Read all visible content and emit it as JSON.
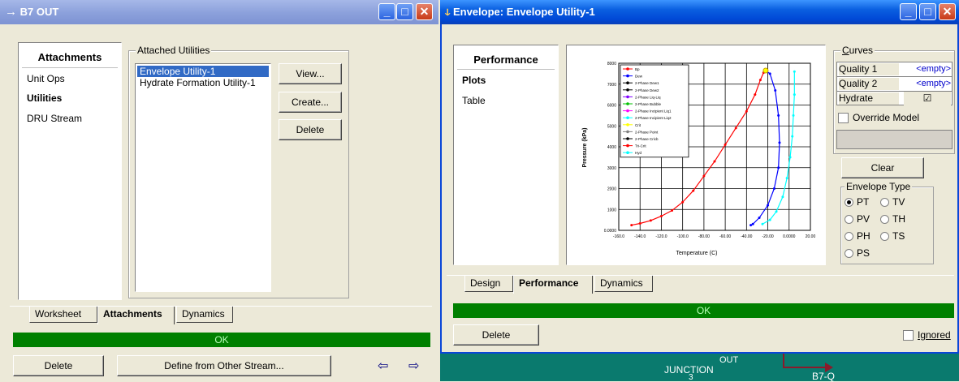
{
  "left_window": {
    "title": "B7 OUT",
    "title_arrow": "→",
    "nav_header": "Attachments",
    "nav_items": [
      "Unit Ops",
      "Utilities",
      "DRU Stream"
    ],
    "attached_utilities_label": "Attached Utilities",
    "utilities": [
      "Envelope Utility-1",
      "Hydrate Formation Utility-1"
    ],
    "buttons": {
      "view": "View...",
      "create": "Create...",
      "delete": "Delete"
    },
    "tabs": [
      "Worksheet",
      "Attachments",
      "Dynamics"
    ],
    "status": "OK",
    "footer": {
      "delete": "Delete",
      "define": "Define from Other Stream...",
      "prev_arrow": "⇦",
      "next_arrow": "⇨"
    }
  },
  "right_window": {
    "title": "Envelope: Envelope Utility-1",
    "nav_header": "Performance",
    "nav_items": [
      "Plots",
      "Table"
    ],
    "curves_label": "Curves",
    "curves": [
      {
        "name": "Quality 1",
        "value": "<empty>"
      },
      {
        "name": "Quality 2",
        "value": "<empty>"
      },
      {
        "name": "Hydrate",
        "value": "☑"
      }
    ],
    "override_model": "Override Model",
    "clear": "Clear",
    "envelope_type_label": "Envelope Type",
    "envelope_types": [
      [
        "PT",
        "TV"
      ],
      [
        "PV",
        "TH"
      ],
      [
        "PH",
        "TS"
      ],
      [
        "PS"
      ]
    ],
    "selected_envelope_type": "PT",
    "tabs": [
      "Design",
      "Performance",
      "Dynamics"
    ],
    "status": "OK",
    "delete": "Delete",
    "ignored": "Ignored"
  },
  "canvas": {
    "labels": [
      "JUNCTION",
      "OUT",
      "3",
      "B7-Q"
    ]
  },
  "chart_data": {
    "type": "line",
    "xlabel": "Temperature (C)",
    "ylabel": "Pressure (kPa)",
    "xlim": [
      -160,
      20
    ],
    "ylim": [
      0,
      8000
    ],
    "x_ticks": [
      "-160.0",
      "-140.0",
      "-120.0",
      "-100.0",
      "-80.00",
      "-60.00",
      "-40.00",
      "-20.00",
      "0.0000",
      "20.00"
    ],
    "y_ticks": [
      "0.0000",
      "1000",
      "2000",
      "3000",
      "4000",
      "5000",
      "6000",
      "7000",
      "8000"
    ],
    "legend": [
      "Bp",
      "Dew",
      "2-Phase Dew1",
      "2-Phase Dew2",
      "2-Phase Liq-Liq",
      "2-Phase Bubble",
      "2-Phase Incipient Liq1",
      "2-Phase Incipient Liq2",
      "Crit",
      "2-Phase Point",
      "2-Phase Cricb",
      "Tri-Crit",
      "Hyd"
    ],
    "legend_colors": [
      "#ff0000",
      "#0000ff",
      "#000000",
      "#000000",
      "#8000ff",
      "#00c000",
      "#ff00ff",
      "#00ffff",
      "#ffff00",
      "#808080",
      "#000000",
      "#ff0000",
      "#00ffff"
    ],
    "series": [
      {
        "name": "Bp",
        "color": "#ff0000",
        "points": [
          [
            -148,
            250
          ],
          [
            -140,
            330
          ],
          [
            -130,
            470
          ],
          [
            -120,
            680
          ],
          [
            -110,
            950
          ],
          [
            -100,
            1350
          ],
          [
            -90,
            1900
          ],
          [
            -80,
            2600
          ],
          [
            -70,
            3300
          ],
          [
            -60,
            4100
          ],
          [
            -50,
            4900
          ],
          [
            -40,
            5700
          ],
          [
            -32,
            6500
          ],
          [
            -27,
            7200
          ],
          [
            -24,
            7550
          ],
          [
            -22,
            7650
          ]
        ]
      },
      {
        "name": "Dew",
        "color": "#0000ff",
        "points": [
          [
            -22,
            7650
          ],
          [
            -18,
            7500
          ],
          [
            -13,
            6700
          ],
          [
            -10,
            5500
          ],
          [
            -9,
            4200
          ],
          [
            -10,
            3000
          ],
          [
            -14,
            2000
          ],
          [
            -20,
            1200
          ],
          [
            -28,
            600
          ],
          [
            -34,
            300
          ],
          [
            -36,
            250
          ]
        ]
      },
      {
        "name": "Crit",
        "color": "#ffff00",
        "points": [
          [
            -22,
            7650
          ]
        ]
      },
      {
        "name": "Hyd",
        "color": "#00ffff",
        "points": [
          [
            -25,
            300
          ],
          [
            -18,
            500
          ],
          [
            -12,
            900
          ],
          [
            -6,
            1600
          ],
          [
            -2,
            2500
          ],
          [
            1,
            3500
          ],
          [
            3,
            4500
          ],
          [
            4,
            5500
          ],
          [
            5,
            6500
          ],
          [
            5,
            7600
          ]
        ]
      }
    ]
  }
}
